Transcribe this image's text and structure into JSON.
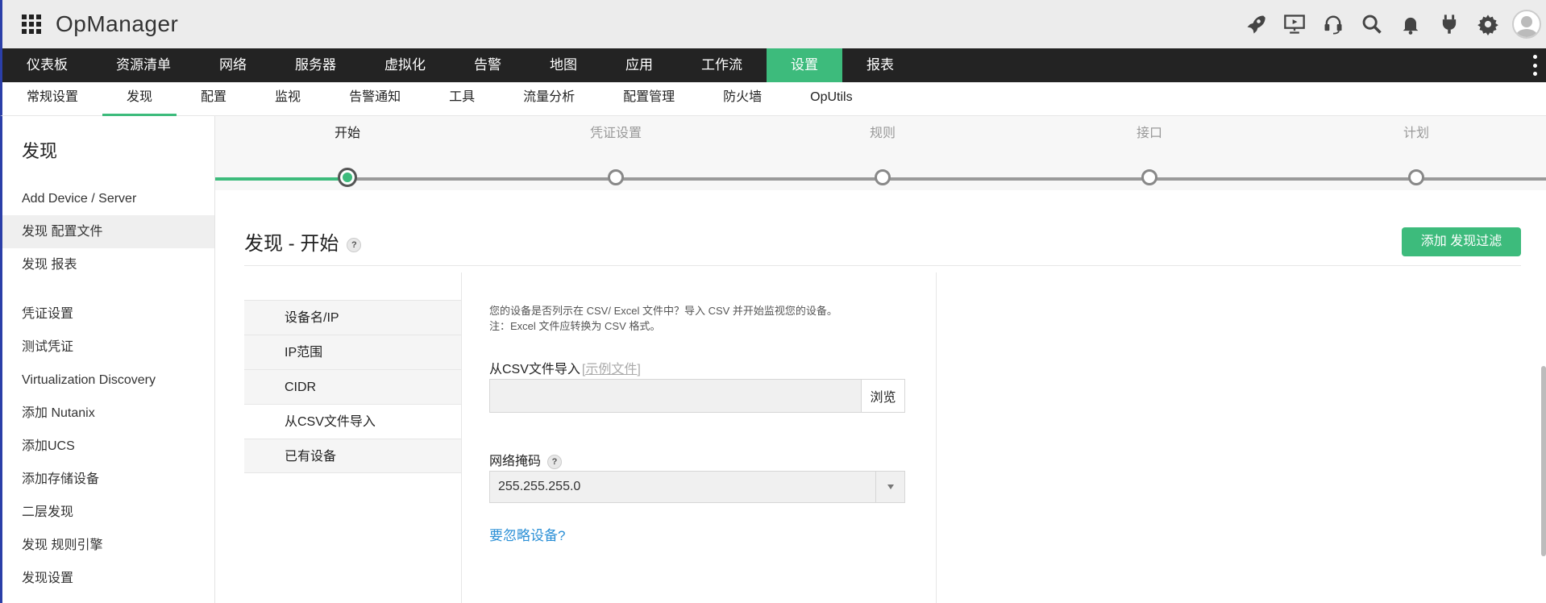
{
  "app": {
    "title": "OpManager"
  },
  "header_icons": [
    "rocket-icon",
    "presentation-icon",
    "headset-icon",
    "search-icon",
    "bell-icon",
    "plug-icon",
    "gear-icon",
    "user-avatar-icon"
  ],
  "main_nav": {
    "items": [
      {
        "label": "仪表板"
      },
      {
        "label": "资源清单"
      },
      {
        "label": "网络"
      },
      {
        "label": "服务器"
      },
      {
        "label": "虚拟化"
      },
      {
        "label": "告警"
      },
      {
        "label": "地图"
      },
      {
        "label": "应用"
      },
      {
        "label": "工作流"
      },
      {
        "label": "设置"
      },
      {
        "label": "报表"
      }
    ],
    "active": "设置"
  },
  "sub_nav": {
    "items": [
      {
        "label": "常规设置"
      },
      {
        "label": "发现"
      },
      {
        "label": "配置"
      },
      {
        "label": "监视"
      },
      {
        "label": "告警通知"
      },
      {
        "label": "工具"
      },
      {
        "label": "流量分析"
      },
      {
        "label": "配置管理"
      },
      {
        "label": "防火墙"
      },
      {
        "label": "OpUtils"
      }
    ],
    "active": "发现"
  },
  "sidebar": {
    "title": "发现",
    "group1": [
      {
        "label": "Add Device / Server"
      },
      {
        "label": "发现 配置文件"
      },
      {
        "label": "发现 报表"
      }
    ],
    "group2": [
      {
        "label": "凭证设置"
      },
      {
        "label": "测试凭证"
      },
      {
        "label": "Virtualization Discovery"
      },
      {
        "label": "添加 Nutanix"
      },
      {
        "label": "添加UCS"
      },
      {
        "label": "添加存储设备"
      },
      {
        "label": "二层发现"
      },
      {
        "label": "发现 规则引擎"
      },
      {
        "label": "发现设置"
      }
    ],
    "active": "发现 配置文件"
  },
  "stepper": {
    "steps": [
      {
        "label": "开始"
      },
      {
        "label": "凭证设置"
      },
      {
        "label": "规则"
      },
      {
        "label": "接口"
      },
      {
        "label": "计划"
      }
    ],
    "active_index": 0
  },
  "page": {
    "title": "发现 - 开始",
    "help": "?",
    "add_filter_button": "添加 发现过滤"
  },
  "methods": {
    "items": [
      {
        "label": "设备名/IP"
      },
      {
        "label": "IP范围"
      },
      {
        "label": "CIDR"
      },
      {
        "label": "从CSV文件导入"
      },
      {
        "label": "已有设备"
      }
    ],
    "active": "从CSV文件导入"
  },
  "form": {
    "desc_line1": "您的设备是否列示在 CSV/ Excel 文件中？导入 CSV 并开始监视您的设备。",
    "desc_line2": "注：Excel 文件应转换为 CSV 格式。",
    "csv_label": "从CSV文件导入",
    "sample_link": "[示例文件]",
    "file_value": "",
    "browse_button": "浏览",
    "netmask_label": "网络掩码",
    "netmask_value": "255.255.255.0",
    "ignore_link": "要忽略设备?"
  },
  "colors": {
    "accent": "#3dbb7c",
    "nav_bg": "#232323",
    "link": "#2a8fd6",
    "window_border": "#2b3fa8"
  }
}
